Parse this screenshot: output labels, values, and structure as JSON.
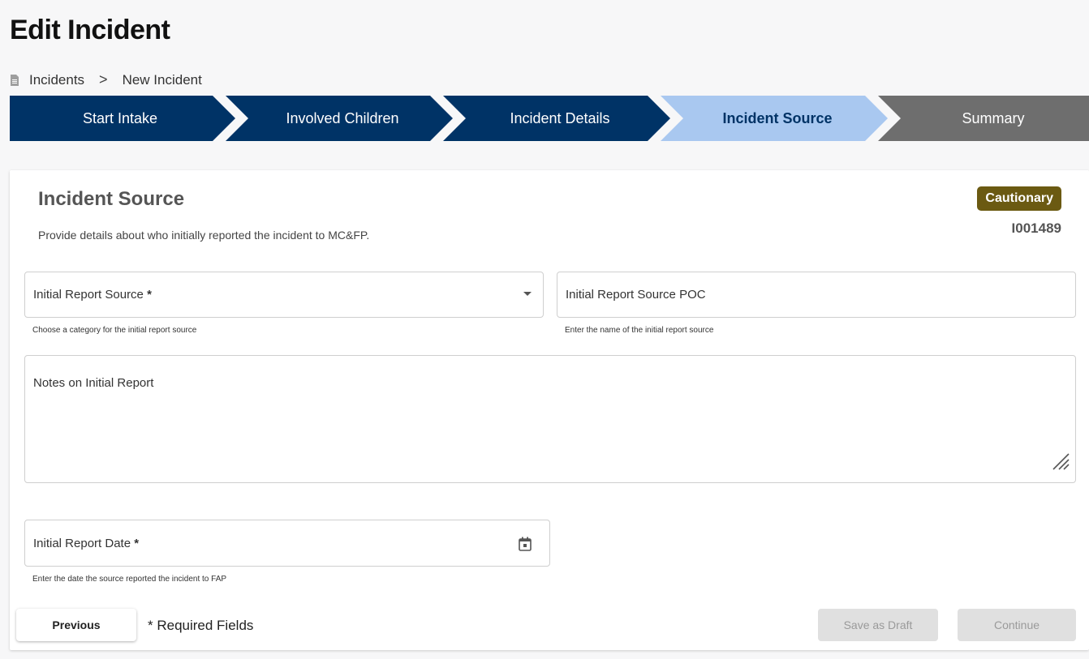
{
  "page": {
    "title": "Edit Incident"
  },
  "breadcrumb": {
    "parent": "Incidents",
    "separator": ">",
    "current": "New Incident"
  },
  "stepper": {
    "steps": [
      {
        "label": "Start Intake",
        "state": "completed"
      },
      {
        "label": "Involved Children",
        "state": "completed"
      },
      {
        "label": "Incident Details",
        "state": "completed"
      },
      {
        "label": "Incident Source",
        "state": "active"
      },
      {
        "label": "Summary",
        "state": "upcoming"
      }
    ],
    "colors": {
      "completed": "#003366",
      "active": "#a9c8f0",
      "upcoming": "#6e6e6e"
    }
  },
  "section": {
    "title": "Incident Source",
    "description": "Provide details about who initially reported the incident to MC&FP.",
    "badge": "Cautionary",
    "badge_color": "#6b5a12",
    "incident_id": "I001489"
  },
  "form": {
    "report_source": {
      "label": "Initial Report Source",
      "required_mark": "*",
      "hint": "Choose a category for the initial report source",
      "icon": "chevron-down-icon"
    },
    "report_source_poc": {
      "label": "Initial Report Source POC",
      "hint": "Enter the name of the initial report source"
    },
    "notes": {
      "label": "Notes on Initial Report",
      "icon": "resize-handle-icon"
    },
    "report_date": {
      "label": "Initial Report Date",
      "required_mark": "*",
      "hint": "Enter the date the source reported the incident to FAP",
      "icon": "calendar-icon"
    }
  },
  "footer": {
    "previous_label": "Previous",
    "required_note": "* Required Fields",
    "save_draft_label": "Save as Draft",
    "continue_label": "Continue"
  }
}
